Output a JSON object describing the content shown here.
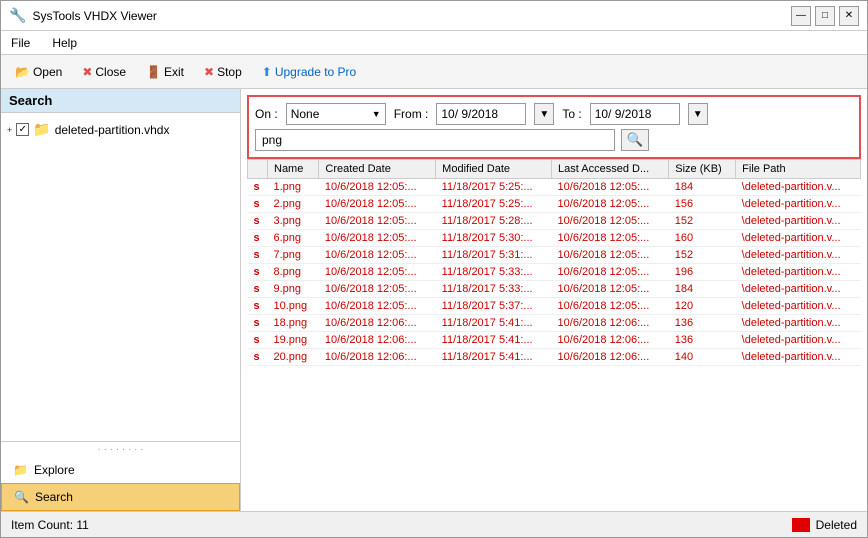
{
  "window": {
    "title": "SysTools VHDX Viewer"
  },
  "menu": {
    "items": [
      "File",
      "Help"
    ]
  },
  "toolbar": {
    "buttons": [
      {
        "id": "open",
        "label": "Open",
        "icon": "📂"
      },
      {
        "id": "close",
        "label": "Close",
        "icon": "✖"
      },
      {
        "id": "exit",
        "label": "Exit",
        "icon": "🚪"
      },
      {
        "id": "stop",
        "label": "Stop",
        "icon": "✖"
      },
      {
        "id": "upgrade",
        "label": "Upgrade to Pro",
        "icon": "⬆"
      }
    ]
  },
  "sidebar": {
    "header": "Search",
    "tree": {
      "item": "deleted-partition.vhdx"
    },
    "nav": [
      {
        "id": "explore",
        "label": "Explore",
        "icon": "📁"
      },
      {
        "id": "search",
        "label": "Search",
        "icon": "🔍",
        "active": true
      }
    ]
  },
  "search": {
    "on_label": "On :",
    "on_value": "None",
    "from_label": "From :",
    "from_value": "10/ 9/2018",
    "to_label": "To :",
    "to_value": "10/ 9/2018",
    "query": "png",
    "search_button_icon": "🔍"
  },
  "table": {
    "columns": [
      "Name",
      "Created Date",
      "Modified Date",
      "Last Accessed D...",
      "Size (KB)",
      "File Path"
    ],
    "rows": [
      {
        "name": "1.png",
        "created": "10/6/2018 12:05:...",
        "modified": "11/18/2017 5:25:...",
        "accessed": "10/6/2018 12:05:...",
        "size": "184",
        "path": "\\deleted-partition.v..."
      },
      {
        "name": "2.png",
        "created": "10/6/2018 12:05:...",
        "modified": "11/18/2017 5:25:...",
        "accessed": "10/6/2018 12:05:...",
        "size": "156",
        "path": "\\deleted-partition.v..."
      },
      {
        "name": "3.png",
        "created": "10/6/2018 12:05:...",
        "modified": "11/18/2017 5:28:...",
        "accessed": "10/6/2018 12:05:...",
        "size": "152",
        "path": "\\deleted-partition.v..."
      },
      {
        "name": "6.png",
        "created": "10/6/2018 12:05:...",
        "modified": "11/18/2017 5:30:...",
        "accessed": "10/6/2018 12:05:...",
        "size": "160",
        "path": "\\deleted-partition.v..."
      },
      {
        "name": "7.png",
        "created": "10/6/2018 12:05:...",
        "modified": "11/18/2017 5:31:...",
        "accessed": "10/6/2018 12:05:...",
        "size": "152",
        "path": "\\deleted-partition.v..."
      },
      {
        "name": "8.png",
        "created": "10/6/2018 12:05:...",
        "modified": "11/18/2017 5:33:...",
        "accessed": "10/6/2018 12:05:...",
        "size": "196",
        "path": "\\deleted-partition.v..."
      },
      {
        "name": "9.png",
        "created": "10/6/2018 12:05:...",
        "modified": "11/18/2017 5:33:...",
        "accessed": "10/6/2018 12:05:...",
        "size": "184",
        "path": "\\deleted-partition.v..."
      },
      {
        "name": "10.png",
        "created": "10/6/2018 12:05:...",
        "modified": "11/18/2017 5:37:...",
        "accessed": "10/6/2018 12:05:...",
        "size": "120",
        "path": "\\deleted-partition.v..."
      },
      {
        "name": "18.png",
        "created": "10/6/2018 12:06:...",
        "modified": "11/18/2017 5:41:...",
        "accessed": "10/6/2018 12:06:...",
        "size": "136",
        "path": "\\deleted-partition.v..."
      },
      {
        "name": "19.png",
        "created": "10/6/2018 12:06:...",
        "modified": "11/18/2017 5:41:...",
        "accessed": "10/6/2018 12:06:...",
        "size": "136",
        "path": "\\deleted-partition.v..."
      },
      {
        "name": "20.png",
        "created": "10/6/2018 12:06:...",
        "modified": "11/18/2017 5:41:...",
        "accessed": "10/6/2018 12:06:...",
        "size": "140",
        "path": "\\deleted-partition.v..."
      }
    ]
  },
  "status": {
    "item_count_label": "Item Count: 11",
    "deleted_label": "Deleted"
  }
}
